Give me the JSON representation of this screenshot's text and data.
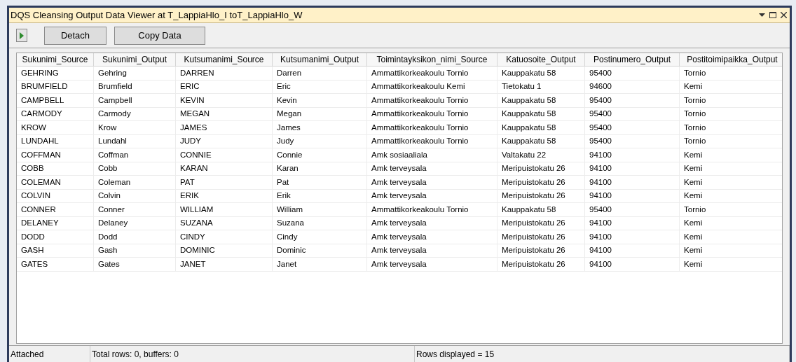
{
  "window": {
    "title": "DQS Cleansing Output Data Viewer at T_LappiaHlo_I toT_LappiaHlo_W"
  },
  "toolbar": {
    "buttons": [
      "Detach",
      "Copy Data"
    ]
  },
  "table": {
    "columns": [
      "Sukunimi_Source",
      "Sukunimi_Output",
      "Kutsumanimi_Source",
      "Kutsumanimi_Output",
      "Toimintayksikon_nimi_Source",
      "Katuosoite_Output",
      "Postinumero_Output",
      "Postitoimipaikka_Output"
    ],
    "rows": [
      [
        "GEHRING",
        "Gehring",
        "DARREN",
        "Darren",
        "Ammattikorkeakoulu Tornio",
        "Kauppakatu 58",
        "95400",
        "Tornio"
      ],
      [
        "BRUMFIELD",
        "Brumfield",
        "ERIC",
        "Eric",
        "Ammattikorkeakoulu Kemi",
        "Tietokatu 1",
        "94600",
        "Kemi"
      ],
      [
        "CAMPBELL",
        "Campbell",
        "KEVIN",
        "Kevin",
        "Ammattikorkeakoulu Tornio",
        "Kauppakatu 58",
        "95400",
        "Tornio"
      ],
      [
        "CARMODY",
        "Carmody",
        "MEGAN",
        "Megan",
        "Ammattikorkeakoulu Tornio",
        "Kauppakatu 58",
        "95400",
        "Tornio"
      ],
      [
        "KROW",
        "Krow",
        "JAMES",
        "James",
        "Ammattikorkeakoulu Tornio",
        "Kauppakatu 58",
        "95400",
        "Tornio"
      ],
      [
        "LUNDAHL",
        "Lundahl",
        "JUDY",
        "Judy",
        "Ammattikorkeakoulu Tornio",
        "Kauppakatu 58",
        "95400",
        "Tornio"
      ],
      [
        "COFFMAN",
        "Coffman",
        "CONNIE",
        "Connie",
        "Amk sosiaaliala",
        "Valtakatu 22",
        "94100",
        "Kemi"
      ],
      [
        "COBB",
        "Cobb",
        "KARAN",
        "Karan",
        "Amk terveysala",
        "Meripuistokatu 26",
        "94100",
        "Kemi"
      ],
      [
        "COLEMAN",
        "Coleman",
        "PAT",
        "Pat",
        "Amk terveysala",
        "Meripuistokatu 26",
        "94100",
        "Kemi"
      ],
      [
        "COLVIN",
        "Colvin",
        "ERIK",
        "Erik",
        "Amk terveysala",
        "Meripuistokatu 26",
        "94100",
        "Kemi"
      ],
      [
        "CONNER",
        "Conner",
        "WILLIAM",
        "William",
        "Ammattikorkeakoulu Tornio",
        "Kauppakatu 58",
        "95400",
        "Tornio"
      ],
      [
        "DELANEY",
        "Delaney",
        "SUZANA",
        "Suzana",
        "Amk terveysala",
        "Meripuistokatu 26",
        "94100",
        "Kemi"
      ],
      [
        "DODD",
        "Dodd",
        "CINDY",
        "Cindy",
        "Amk terveysala",
        "Meripuistokatu 26",
        "94100",
        "Kemi"
      ],
      [
        "GASH",
        "Gash",
        "DOMINIC",
        "Dominic",
        "Amk terveysala",
        "Meripuistokatu 26",
        "94100",
        "Kemi"
      ],
      [
        "GATES",
        "Gates",
        "JANET",
        "Janet",
        "Amk terveysala",
        "Meripuistokatu 26",
        "94100",
        "Kemi"
      ]
    ]
  },
  "status_bar": [
    "Attached",
    "Total rows: 0, buffers: 0",
    "Rows displayed = 15"
  ]
}
